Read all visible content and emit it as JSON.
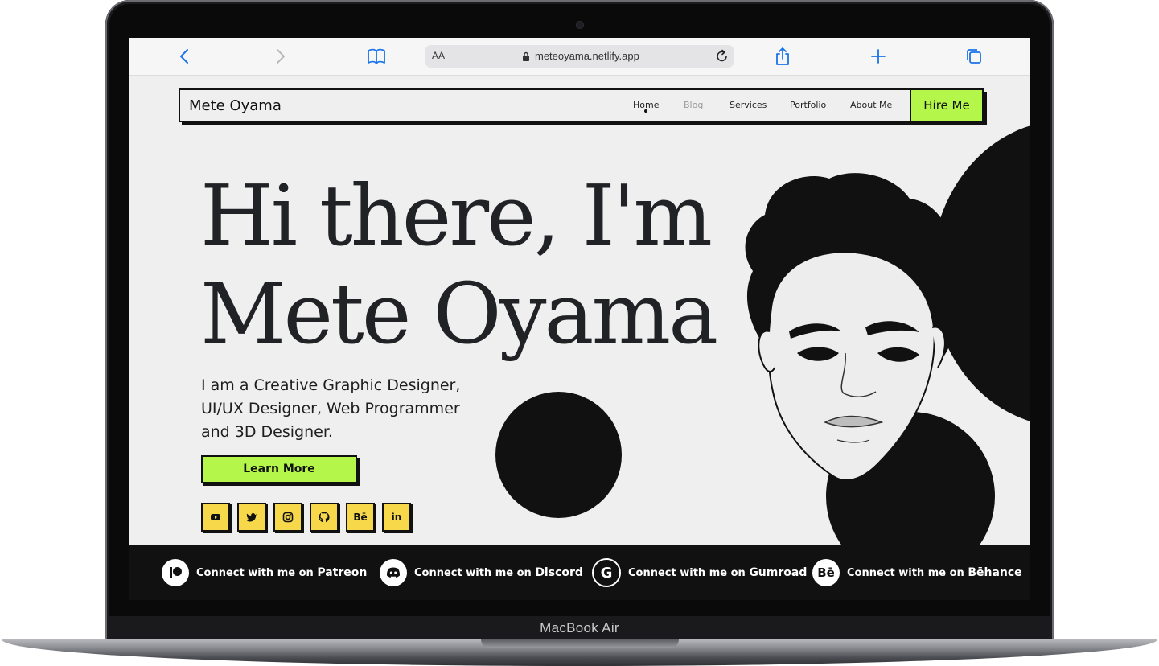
{
  "device": {
    "brand_label": "MacBook Air"
  },
  "browser": {
    "aa_label": "AA",
    "url": "meteoyama.netlify.app",
    "icons": [
      "back-icon",
      "forward-icon",
      "bookmarks-icon",
      "lock-icon",
      "reload-icon",
      "share-icon",
      "plus-icon",
      "tabs-icon"
    ],
    "accent_color": "#1a73e8"
  },
  "nav": {
    "logo": "Mete Oyama",
    "links": [
      "Home",
      "Blog",
      "Services",
      "Portfolio",
      "About Me"
    ],
    "active_link": "Home",
    "hire_label": "Hire Me",
    "accent_color": "#b4f74a"
  },
  "hero": {
    "title": "Hi there, I'm Mete Oyama",
    "subtitle": "I am a Creative Graphic Designer, UI/UX Designer, Web Programmer and 3D Designer.",
    "cta_label": "Learn More",
    "social_icons": [
      "youtube-icon",
      "twitter-icon",
      "instagram-icon",
      "github-icon",
      "behance-icon",
      "linkedin-icon"
    ],
    "social_labels": {
      "behance": "Bē",
      "linkedin": "in"
    },
    "social_color": "#f7d84a"
  },
  "footer": {
    "items": [
      {
        "prefix": "Connect with me on ",
        "platform": "Patreon",
        "icon": "patreon-icon"
      },
      {
        "prefix": "Connect with me on ",
        "platform": "Discord",
        "icon": "discord-icon"
      },
      {
        "prefix": "Connect with me on ",
        "platform": "Gumroad",
        "icon": "gumroad-icon",
        "icon_letter": "G"
      },
      {
        "prefix": "Connect with me on ",
        "platform": "Bēhance",
        "icon": "behance-icon",
        "icon_letter": "Bē"
      }
    ]
  }
}
